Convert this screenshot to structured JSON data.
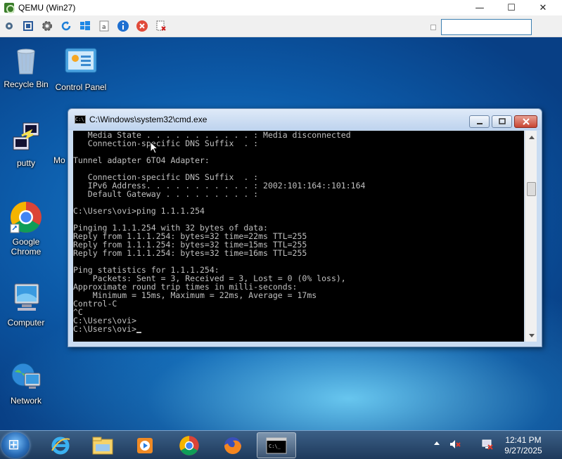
{
  "host_window": {
    "title": "QEMU (Win27)",
    "minimize": "—",
    "maximize": "☐",
    "close": "✕"
  },
  "toolbar": {
    "icons": [
      "settings-icon",
      "fullscreen-icon",
      "gear-icon",
      "refresh-icon",
      "windows-icon",
      "text-icon",
      "info-icon",
      "stop-icon",
      "screenshot-icon"
    ]
  },
  "desktop": {
    "icons": [
      {
        "label": "Recycle Bin"
      },
      {
        "label": "Control Panel"
      },
      {
        "label": "putty"
      },
      {
        "label": "Mo"
      },
      {
        "label": "Google Chrome"
      },
      {
        "label": "Computer"
      },
      {
        "label": "Network"
      }
    ]
  },
  "cmd": {
    "title": "C:\\Windows\\system32\\cmd.exe",
    "icon_text": "C:\\",
    "lines": [
      "   Media State . . . . . . . . . . . : Media disconnected",
      "   Connection-specific DNS Suffix  . :",
      "",
      "Tunnel adapter 6TO4 Adapter:",
      "",
      "   Connection-specific DNS Suffix  . :",
      "   IPv6 Address. . . . . . . . . . . : 2002:101:164::101:164",
      "   Default Gateway . . . . . . . . . :",
      "",
      "C:\\Users\\ovi>ping 1.1.1.254",
      "",
      "Pinging 1.1.1.254 with 32 bytes of data:",
      "Reply from 1.1.1.254: bytes=32 time=22ms TTL=255",
      "Reply from 1.1.1.254: bytes=32 time=15ms TTL=255",
      "Reply from 1.1.1.254: bytes=32 time=16ms TTL=255",
      "",
      "Ping statistics for 1.1.1.254:",
      "    Packets: Sent = 3, Received = 3, Lost = 0 (0% loss),",
      "Approximate round trip times in milli-seconds:",
      "    Minimum = 15ms, Maximum = 22ms, Average = 17ms",
      "Control-C",
      "^C",
      "C:\\Users\\ovi>",
      "C:\\Users\\ovi>"
    ]
  },
  "taskbar": {
    "apps": [
      "internet-explorer-icon",
      "file-explorer-icon",
      "media-player-icon",
      "chrome-icon",
      "firefox-icon",
      "cmd-icon"
    ],
    "clock_time": "12:41 PM",
    "clock_date": "9/27/2025"
  },
  "colors": {
    "console_bg": "#000000",
    "console_text": "#c0c0c0",
    "desktop_blue": "#0c5aa8",
    "taskbar": "#1e3a5c"
  }
}
